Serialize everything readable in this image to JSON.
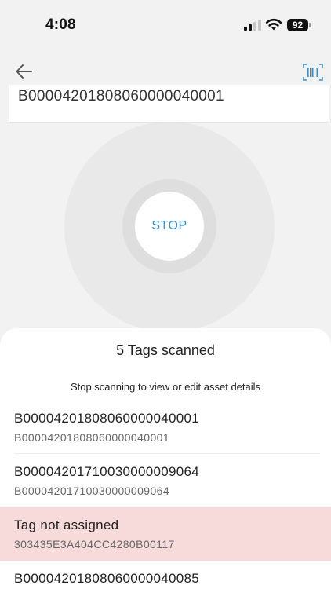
{
  "status_bar": {
    "time": "4:08",
    "battery": "92"
  },
  "tag_field": {
    "value": "B0000420180806000004000​1"
  },
  "scanner": {
    "stop_label": "STOP",
    "accent_color": "#3a8fc9"
  },
  "sheet": {
    "title": "5 Tags scanned",
    "hint": "Stop scanning to view or edit asset details",
    "items": [
      {
        "primary": "B00004201808060000040001",
        "secondary": "B00004201808060000040001",
        "state": "assigned"
      },
      {
        "primary": "B00004201710030000009064",
        "secondary": "B00004201710030000009064",
        "state": "assigned"
      },
      {
        "primary": "Tag not assigned",
        "secondary": "303435E3A404CC4280B00117",
        "state": "unassigned"
      },
      {
        "primary": "B00004201808060000040085",
        "secondary": "",
        "state": "assigned"
      }
    ]
  },
  "icons": {
    "back": "arrow-left-icon",
    "barcode": "barcode-scan-icon"
  }
}
